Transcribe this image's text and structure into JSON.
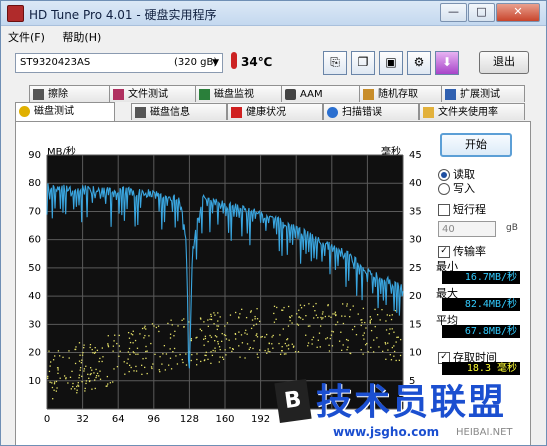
{
  "window": {
    "title": "HD Tune Pro 4.01 - 硬盘实用程序",
    "minimize": "—",
    "maximize": "□",
    "close": "✕"
  },
  "menu": {
    "file": "文件(F)",
    "help": "帮助(H)"
  },
  "toolbar": {
    "drive_name": "ST9320423AS",
    "drive_size": "(320 gB)",
    "temperature": "34℃",
    "exit_label": "退出",
    "icons": [
      "copy-text-icon",
      "copy-screen-icon",
      "save-icon",
      "options-icon",
      "download-icon"
    ]
  },
  "tabs_top": [
    {
      "label": "擦除",
      "icon": "erase-icon"
    },
    {
      "label": "文件测试",
      "icon": "file-test-icon"
    },
    {
      "label": "磁盘监视",
      "icon": "monitor-icon"
    },
    {
      "label": "AAM",
      "icon": "speaker-icon"
    },
    {
      "label": "随机存取",
      "icon": "random-access-icon"
    },
    {
      "label": "扩展测试",
      "icon": "extended-test-icon"
    }
  ],
  "tabs_bottom": [
    {
      "label": "磁盘测试",
      "icon": "benchmark-icon",
      "active": true
    },
    {
      "label": "磁盘信息",
      "icon": "info-icon"
    },
    {
      "label": "健康状况",
      "icon": "health-icon"
    },
    {
      "label": "扫描错误",
      "icon": "scan-icon"
    },
    {
      "label": "文件夹使用率",
      "icon": "folder-icon"
    }
  ],
  "controls": {
    "start_label": "开始",
    "read_label": "读取",
    "write_label": "写入",
    "mode_selected": "read",
    "short_stroke_label": "短行程",
    "short_stroke_value": "40",
    "short_stroke_unit": "gB",
    "transfer_rate_label": "传输率",
    "min_label": "最小",
    "min_value": "16.7MB/秒",
    "max_label": "最大",
    "max_value": "82.4MB/秒",
    "avg_label": "平均",
    "avg_value": "67.8MB/秒",
    "access_time_label": "存取时间",
    "access_time_value": "18.3 毫秒"
  },
  "watermark": {
    "text": "技术员联盟",
    "url": "www.jsgho.com",
    "url2": "HEIBAI.NET",
    "logo_letter": "B"
  },
  "chart_data": {
    "type": "line",
    "ylabel_left": "MB/秒",
    "ylabel_right": "毫秒",
    "ylim_left": [
      0,
      90
    ],
    "ylim_right": [
      0,
      45
    ],
    "yticks_left": [
      10,
      20,
      30,
      40,
      50,
      60,
      70,
      80,
      90
    ],
    "yticks_right": [
      5,
      10,
      15,
      20,
      25,
      30,
      35,
      40,
      45
    ],
    "xticks": [
      "0",
      "32",
      "64",
      "96",
      "128",
      "160",
      "192"
    ],
    "xlim": [
      0,
      320
    ],
    "grid": true,
    "series": [
      {
        "role": "transfer rate",
        "color": "#3aa6e0",
        "x": [
          0,
          10,
          20,
          30,
          40,
          50,
          60,
          70,
          80,
          90,
          100,
          110,
          120,
          125,
          128,
          131,
          140,
          150,
          160,
          170,
          180,
          190,
          200,
          210,
          220,
          230,
          240,
          250,
          260,
          270,
          280,
          290,
          300,
          310,
          320
        ],
        "y": [
          80,
          80,
          79,
          80,
          79,
          79,
          78,
          79,
          78,
          78,
          77,
          76,
          76,
          60,
          17,
          60,
          76,
          75,
          74,
          73,
          72,
          71,
          70,
          68,
          66,
          64,
          62,
          60,
          58,
          56,
          53,
          50,
          48,
          46,
          44
        ]
      },
      {
        "role": "access time",
        "color": "#e8e46a",
        "x": [
          0,
          40,
          80,
          120,
          160,
          200,
          240,
          280,
          320
        ],
        "y": [
          6,
          8,
          10,
          12,
          13,
          14,
          15,
          14,
          13
        ]
      }
    ]
  }
}
